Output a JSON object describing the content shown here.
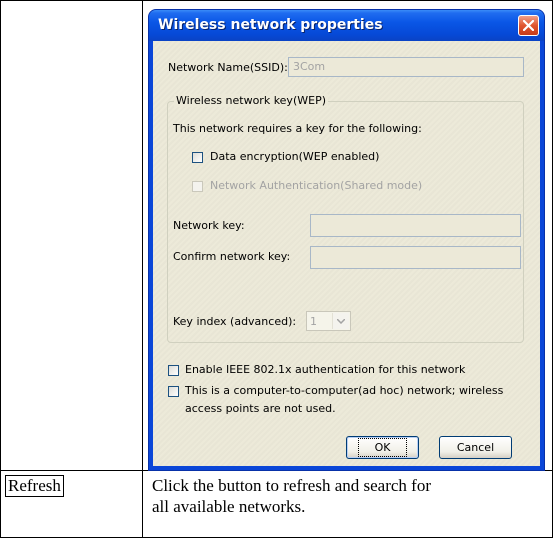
{
  "dialog": {
    "title": "Wireless network properties",
    "ssid_label": "Network Name(SSID):",
    "ssid_value": "3Com",
    "wep_group_label": "Wireless network key(WEP)",
    "requires_key_text": "This network requires a key for the following:",
    "data_encryption_label": "Data encryption(WEP enabled)",
    "data_encryption_checked": false,
    "network_auth_label": "Network Authentication(Shared mode)",
    "network_auth_checked": false,
    "network_key_label": "Network key:",
    "network_key_value": "",
    "confirm_key_label": "Confirm network key:",
    "confirm_key_value": "",
    "key_index_label": "Key index (advanced):",
    "key_index_value": "1",
    "ieee_label": "Enable IEEE 802.1x authentication for this network",
    "ieee_checked": false,
    "adhoc_label_line1": "This is a computer-to-computer(ad hoc) network; wireless",
    "adhoc_label_line2": "access points are not used.",
    "adhoc_checked": false,
    "ok_label": "OK",
    "cancel_label": "Cancel"
  },
  "table": {
    "term": "Refresh",
    "description_line1": "Click the button to refresh and search for",
    "description_line2": "all available networks."
  },
  "colors": {
    "titlebar": "#0a56e6",
    "close_button": "#e0562f",
    "client_background": "#ece9d8"
  }
}
